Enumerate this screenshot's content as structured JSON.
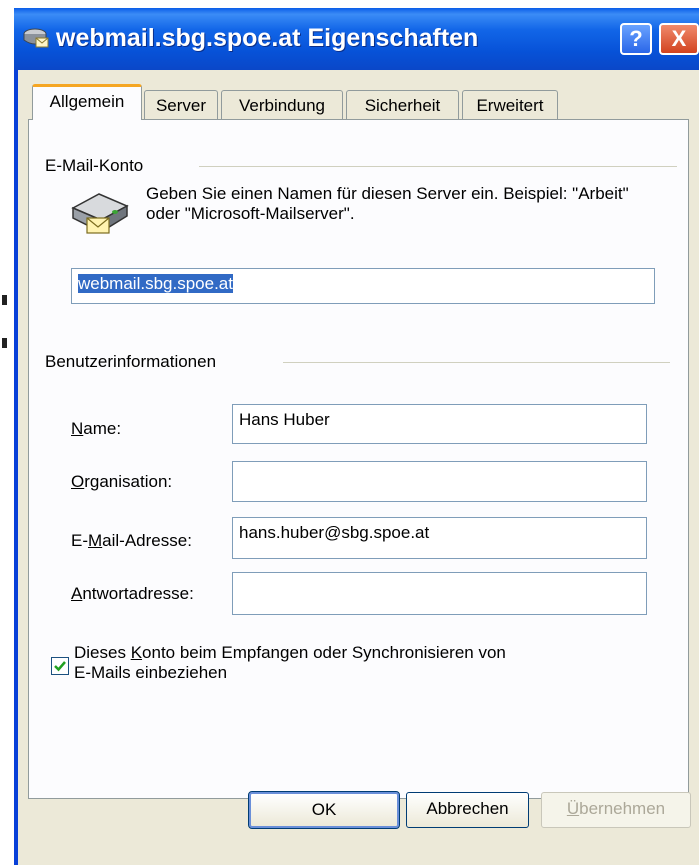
{
  "window": {
    "title": "webmail.sbg.spoe.at Eigenschaften",
    "help_label": "?",
    "close_label": "X"
  },
  "tabs": [
    {
      "label": "Allgemein",
      "active": true
    },
    {
      "label": "Server",
      "active": false
    },
    {
      "label": "Verbindung",
      "active": false
    },
    {
      "label": "Sicherheit",
      "active": false
    },
    {
      "label": "Erweitert",
      "active": false
    }
  ],
  "account": {
    "group_label": "E-Mail-Konto",
    "description": "Geben Sie einen Namen für diesen Server ein. Beispiel: \"Arbeit\" oder \"Microsoft-Mailserver\".",
    "name_value": "webmail.sbg.spoe.at"
  },
  "user_info": {
    "group_label": "Benutzerinformationen",
    "fields": [
      {
        "label_key": "N",
        "label_rest": "ame:",
        "value": "Hans Huber"
      },
      {
        "label_key": "O",
        "label_rest": "rganisation:",
        "value": ""
      },
      {
        "label_pre": "E-",
        "label_key": "M",
        "label_rest": "ail-Adresse:",
        "value": "hans.huber@sbg.spoe.at"
      },
      {
        "label_key": "A",
        "label_rest": "ntwortadresse:",
        "value": ""
      }
    ]
  },
  "include_checkbox": {
    "checked": true,
    "label_pre": "Dieses ",
    "label_key": "K",
    "label_rest": "onto beim Empfangen oder Synchronisieren von",
    "label_line2": "E-Mails einbeziehen"
  },
  "buttons": {
    "ok": "OK",
    "cancel": "Abbrechen",
    "apply_key": "Ü",
    "apply_rest": "bernehmen"
  },
  "colors": {
    "titlebar": "#0a47c8",
    "face": "#ece9d8",
    "tab_highlight": "#f5a623",
    "selection": "#316ac5"
  },
  "icons": {
    "title": "mail-server-icon",
    "account": "mail-server-icon",
    "checkbox": "check-icon"
  }
}
